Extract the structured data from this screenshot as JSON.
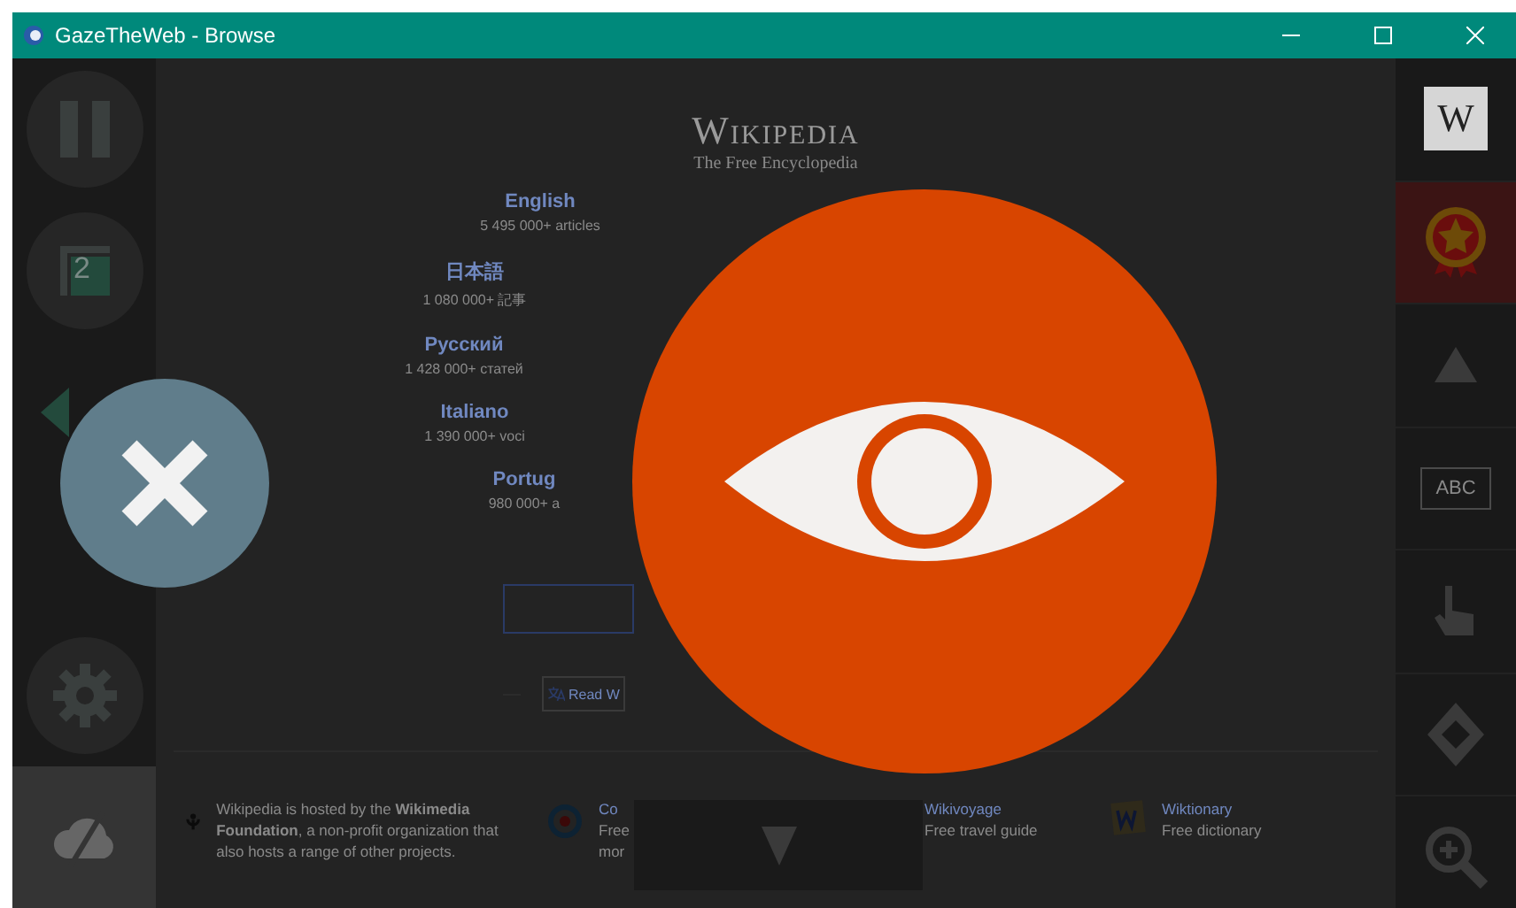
{
  "window": {
    "title": "GazeTheWeb - Browse"
  },
  "left_toolbar": [
    {
      "kind": "pause",
      "selected": false
    },
    {
      "kind": "tabs",
      "label": "2",
      "selected": false
    },
    {
      "kind": "back",
      "selected": false
    },
    {
      "kind": "settings",
      "selected": false
    },
    {
      "kind": "cloud",
      "selected": true
    }
  ],
  "right_toolbar": [
    {
      "kind": "wiki",
      "label": "W",
      "selected": false
    },
    {
      "kind": "bookmark",
      "selected": true
    },
    {
      "kind": "scroll-up",
      "selected": false
    },
    {
      "kind": "keyboard",
      "label": "ABC",
      "selected": false
    },
    {
      "kind": "pointer",
      "selected": false
    },
    {
      "kind": "scroll",
      "selected": false
    },
    {
      "kind": "zoom",
      "selected": false
    }
  ],
  "page": {
    "logo": "Wikipedia",
    "tagline": "The Free Encyclopedia",
    "languages": [
      {
        "name": "English",
        "count": "5 495 000+ articles"
      },
      {
        "name": "日本語",
        "count": "1 080 000+ 記事"
      },
      {
        "name": "Русский",
        "count": "1 428 000+ статей"
      },
      {
        "name": "Italiano",
        "count": "1 390 000+ voci"
      },
      {
        "name": "Portug",
        "count": "980 000+ a"
      }
    ],
    "read_button": "Read W",
    "footer": {
      "hosted": "Wikipedia is hosted by the **Wikimedia Foundation**, a non-profit organization that also hosts a range of other projects.",
      "projects": [
        {
          "kind": "commons",
          "name": "Co",
          "lines": [
            "Free",
            "mor"
          ]
        },
        {
          "kind": "voyage",
          "name": "Wikivoyage",
          "lines": [
            "Free travel guide"
          ]
        },
        {
          "kind": "dictionary",
          "name": "Wiktionary",
          "lines": [
            "Free dictionary"
          ]
        }
      ]
    }
  }
}
